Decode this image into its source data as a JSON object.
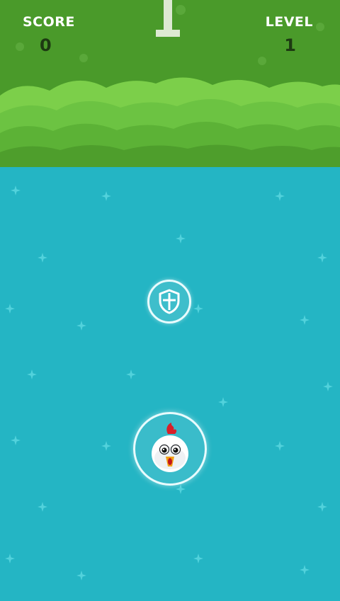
{
  "hud": {
    "score_label": "SCORE",
    "score_value": "0",
    "level_label": "LEVEL",
    "level_value": "1"
  },
  "powerup": {
    "icon": "shield-icon",
    "type": "shield"
  },
  "player": {
    "icon": "chicken-icon"
  },
  "colors": {
    "sky": "#4a9a2a",
    "water": "#24b5c4",
    "hill_light": "#7ccf4a",
    "hill_mid": "#62b93a",
    "hill_dark": "#4e9e2c"
  }
}
